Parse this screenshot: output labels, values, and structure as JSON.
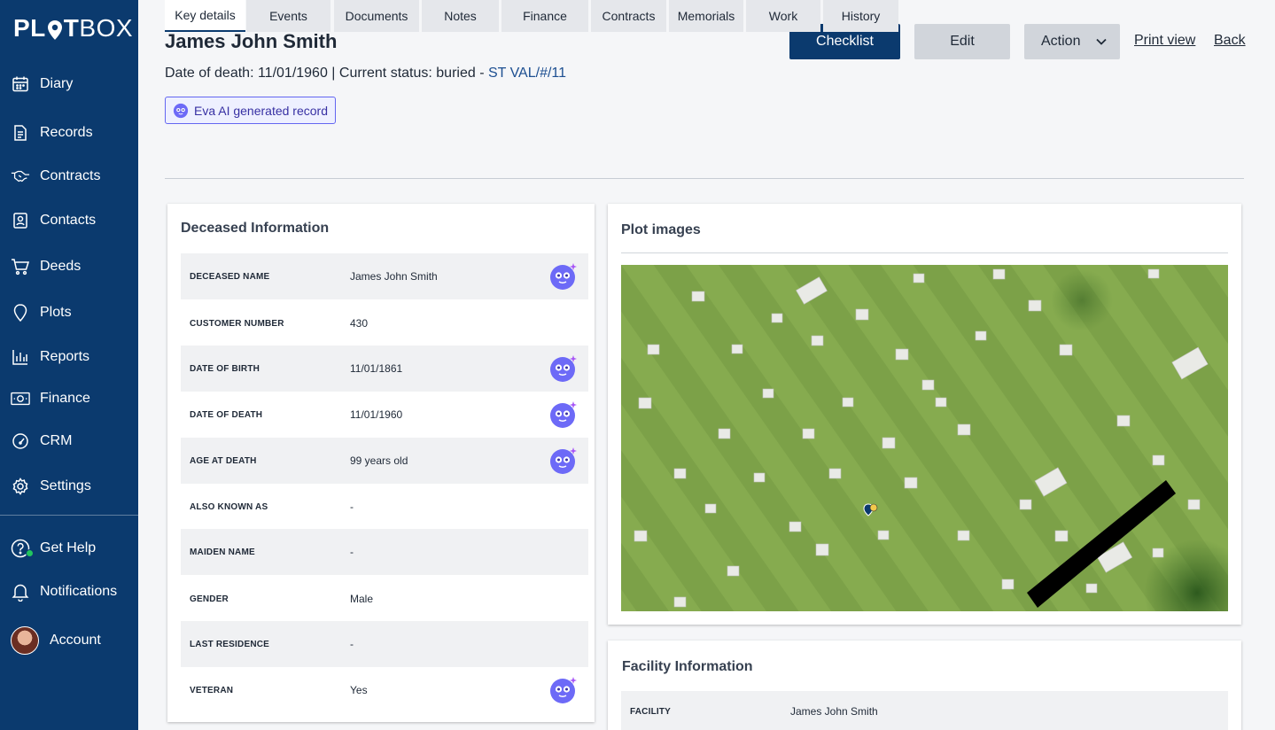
{
  "app": {
    "logo_left": "PL",
    "logo_mid": "T",
    "logo_right": "BOX"
  },
  "sidebar": {
    "items": [
      {
        "label": "Diary",
        "icon": "calendar-icon"
      },
      {
        "label": "Records",
        "icon": "document-icon"
      },
      {
        "label": "Contracts",
        "icon": "handshake-icon"
      },
      {
        "label": "Contacts",
        "icon": "contact-card-icon"
      },
      {
        "label": "Deeds",
        "icon": "cart-icon"
      },
      {
        "label": "Plots",
        "icon": "location-pin-icon"
      },
      {
        "label": "Reports",
        "icon": "bar-chart-icon"
      },
      {
        "label": "Finance",
        "icon": "banknote-icon"
      },
      {
        "label": "CRM",
        "icon": "gauge-icon"
      },
      {
        "label": "Settings",
        "icon": "gear-icon"
      }
    ],
    "bottom": [
      {
        "label": "Get Help",
        "icon": "help-icon"
      },
      {
        "label": "Notifications",
        "icon": "bell-icon"
      },
      {
        "label": "Account",
        "icon": "avatar"
      }
    ]
  },
  "header": {
    "title": "James John Smith",
    "subline_prefix": "Date of death: 11/01/1960 | Current status: buried - ",
    "plot_ref": "ST VAL/#/11",
    "badge": "Eva AI generated record",
    "checklist": "Checklist",
    "edit": "Edit",
    "action": "Action",
    "print_view": "Print view",
    "back": "Back"
  },
  "tabs": [
    "Key details",
    "Events",
    "Documents",
    "Notes",
    "Finance",
    "Contracts",
    "Memorials",
    "Work",
    "History"
  ],
  "active_tab": "Key details",
  "deceased": {
    "title": "Deceased Information",
    "rows": [
      {
        "key": "DECEASED NAME",
        "value": "James John Smith",
        "ai": true
      },
      {
        "key": "CUSTOMER NUMBER",
        "value": "430",
        "ai": false
      },
      {
        "key": "DATE OF BIRTH",
        "value": "11/01/1861",
        "ai": true
      },
      {
        "key": "DATE OF DEATH",
        "value": "11/01/1960",
        "ai": true
      },
      {
        "key": "AGE AT DEATH",
        "value": "99 years old",
        "ai": true
      },
      {
        "key": "ALSO KNOWN AS",
        "value": "-",
        "ai": false
      },
      {
        "key": "MAIDEN NAME",
        "value": "-",
        "ai": false
      },
      {
        "key": "GENDER",
        "value": "Male",
        "ai": false
      },
      {
        "key": "LAST RESIDENCE",
        "value": "-",
        "ai": false
      },
      {
        "key": "VETERAN",
        "value": "Yes",
        "ai": true
      }
    ]
  },
  "plot_images": {
    "title": "Plot images"
  },
  "facility": {
    "title": "Facility Information",
    "rows": [
      {
        "key": "FACILITY",
        "value": "James John Smith"
      }
    ]
  },
  "colors": {
    "brand": "#0b3a6e",
    "ai_accent": "#6366f1",
    "grass": "#7ca148"
  }
}
